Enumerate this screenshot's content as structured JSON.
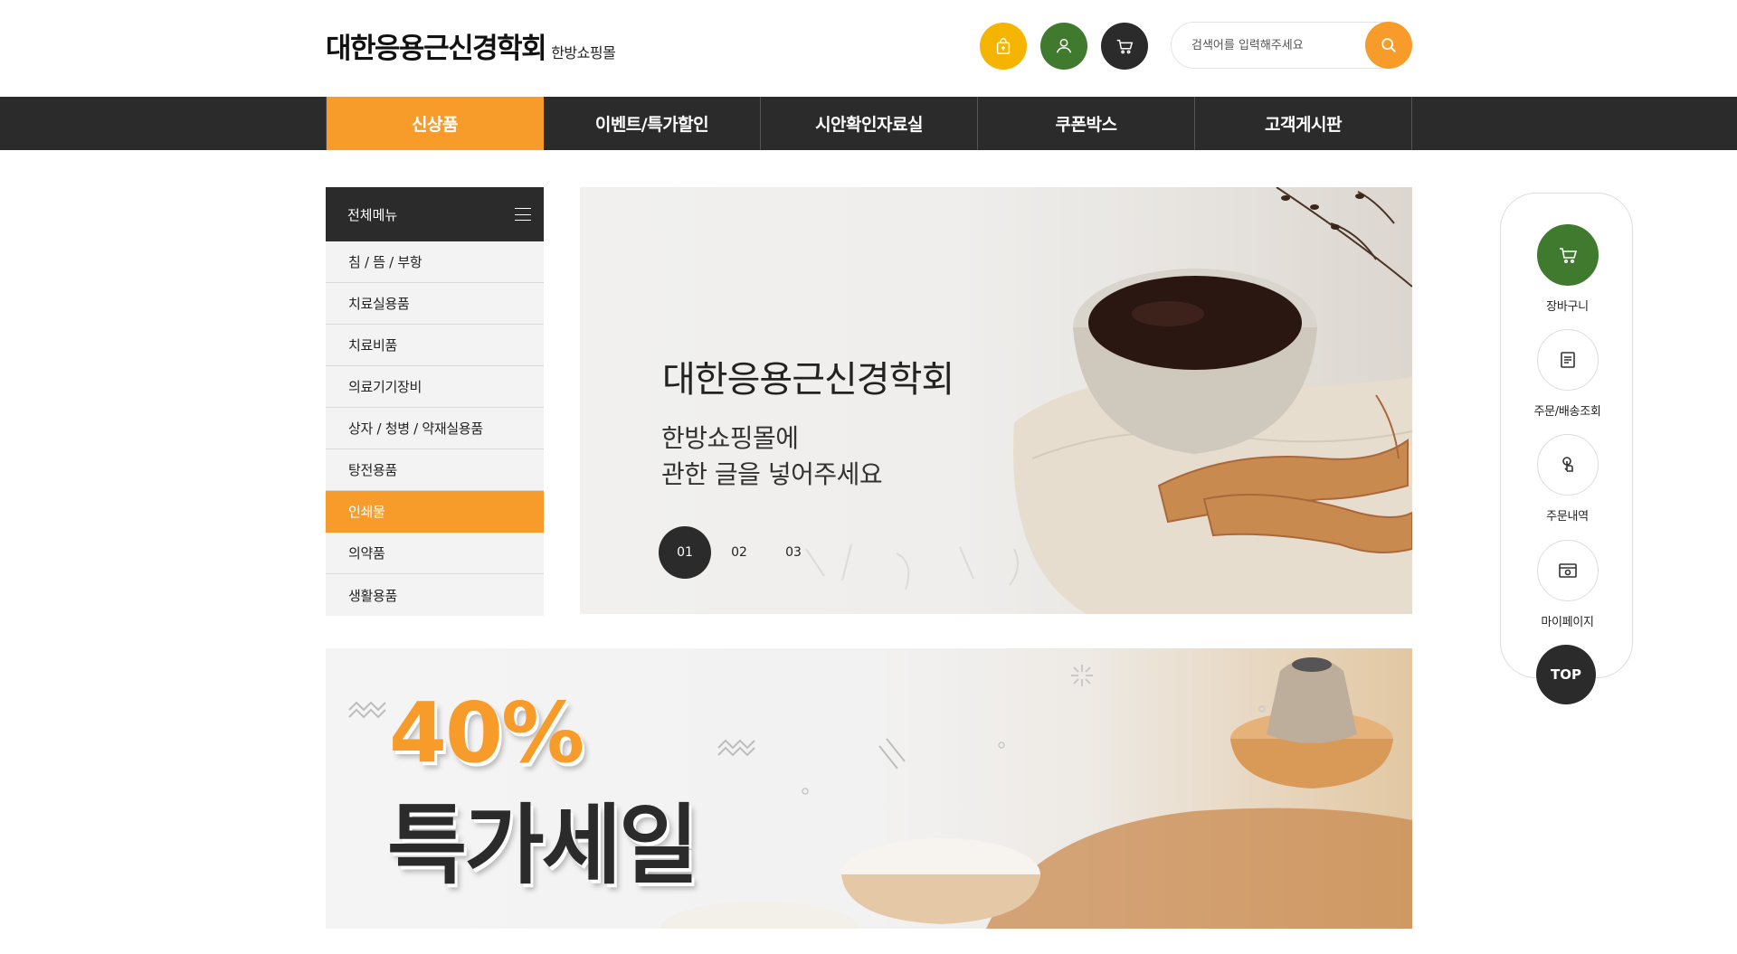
{
  "header": {
    "brand_main": "대한응용근신경학회",
    "brand_sub": "한방쇼핑몰",
    "search_placeholder": "검색어를 입력해주세요"
  },
  "nav": {
    "items": [
      {
        "label": "신상품"
      },
      {
        "label": "이벤트/특가할인"
      },
      {
        "label": "시안확인자료실"
      },
      {
        "label": "쿠폰박스"
      },
      {
        "label": "고객게시판"
      }
    ],
    "active_index": 0
  },
  "side_menu": {
    "title": "전체메뉴",
    "items": [
      {
        "label": "침 / 뜸 / 부항"
      },
      {
        "label": "치료실용품"
      },
      {
        "label": "치료비품"
      },
      {
        "label": "의료기기장비"
      },
      {
        "label": "상자 / 청병 / 약재실용품"
      },
      {
        "label": "탕전용품"
      },
      {
        "label": "인쇄물"
      },
      {
        "label": "의약품"
      },
      {
        "label": "생활용품"
      }
    ],
    "active_index": 6
  },
  "hero": {
    "title": "대한응용근신경학회",
    "subtitle_line1": "한방쇼핑몰에",
    "subtitle_line2": "관한 글을 넣어주세요",
    "slides": [
      "01",
      "02",
      "03"
    ],
    "active_slide": 0
  },
  "sale_banner": {
    "percent": "40%",
    "text": "특가세일"
  },
  "quick_menu": {
    "items": [
      {
        "label": "장바구니",
        "icon": "cart-icon"
      },
      {
        "label": "주문/배송조회",
        "icon": "document-icon"
      },
      {
        "label": "주문내역",
        "icon": "touch-icon"
      },
      {
        "label": "마이페이지",
        "icon": "browser-icon"
      }
    ],
    "top_label": "TOP"
  },
  "colors": {
    "accent_orange": "#f79c2b",
    "dark": "#2b2b2b",
    "green": "#3f7a2f",
    "yellow": "#f4b400"
  }
}
